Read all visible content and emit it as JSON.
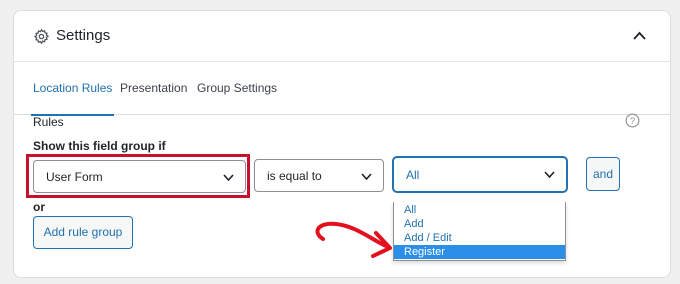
{
  "settings": {
    "title": "Settings",
    "tabs": [
      {
        "label": "Location Rules",
        "active": true
      },
      {
        "label": "Presentation",
        "active": false
      },
      {
        "label": "Group Settings",
        "active": false
      }
    ],
    "rules": {
      "heading": "Rules",
      "condition_label": "Show this field group if",
      "field_select": "User Form",
      "operator_select": "is equal to",
      "value_select": "All",
      "and_button": "and",
      "or_label": "or",
      "add_rule_group_button": "Add rule group",
      "value_options": [
        "All",
        "Add",
        "Add / Edit",
        "Register"
      ],
      "selected_option": "Register"
    }
  },
  "colors": {
    "accent": "#2271b1",
    "highlight": "#c8102e",
    "selected_option_bg": "#2b8fe9"
  },
  "icons": [
    "gear-icon",
    "chevron-up-icon",
    "help-icon",
    "chevron-down-icon"
  ]
}
